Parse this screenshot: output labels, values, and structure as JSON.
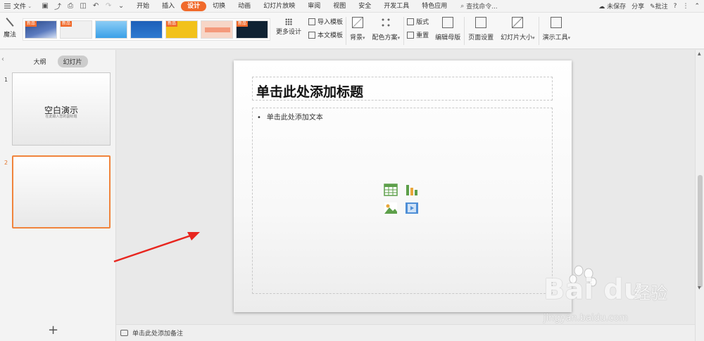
{
  "menu": {
    "file_label": "文件",
    "tabs": [
      "开始",
      "插入",
      "设计",
      "切换",
      "动画",
      "幻灯片放映",
      "审阅",
      "视图",
      "安全",
      "开发工具",
      "特色应用"
    ],
    "active_tab": "设计",
    "search_label": "查找命令...",
    "unsaved_label": "未保存",
    "share_label": "分享",
    "comment_label": "批注",
    "help_label": "?"
  },
  "ribbon": {
    "magic_label": "魔法",
    "template_badge": "新品",
    "template_colors": [
      "#2b4a8a",
      "#f0f0f0",
      "#3aa0e8",
      "#1d5fb8",
      "#f2c21b",
      "#f49a7c",
      "#0f2233"
    ],
    "more_design_label": "更多设计",
    "import_template_label": "导入模板",
    "text_template_label": "本文模板",
    "background_label": "背景",
    "color_scheme_label": "配色方案",
    "layout_label": "版式",
    "reset_label": "重置",
    "edit_master_label": "编辑母版",
    "page_setup_label": "页面设置",
    "slide_size_label": "幻灯片大小",
    "presenter_tools_label": "演示工具"
  },
  "left_panel": {
    "outline_tab": "大纲",
    "slides_tab": "幻灯片",
    "slides": [
      {
        "number": "1",
        "title": "空白演示",
        "subtitle": "在此输入您的副标题"
      },
      {
        "number": "2",
        "title": "",
        "subtitle": ""
      }
    ],
    "add_slide_label": "+"
  },
  "slide": {
    "title_placeholder": "单击此处添加标题",
    "body_placeholder": "单击此处添加文本"
  },
  "notes": {
    "placeholder": "单击此处添加备注"
  },
  "watermark": {
    "logo_text": "Bai du",
    "brand_text": "经验",
    "url_text": "jingyan.baidu.com"
  },
  "colors": {
    "accent": "#f06a2b",
    "selection_border": "#f0843c",
    "annotation_arrow": "#e8261f"
  }
}
